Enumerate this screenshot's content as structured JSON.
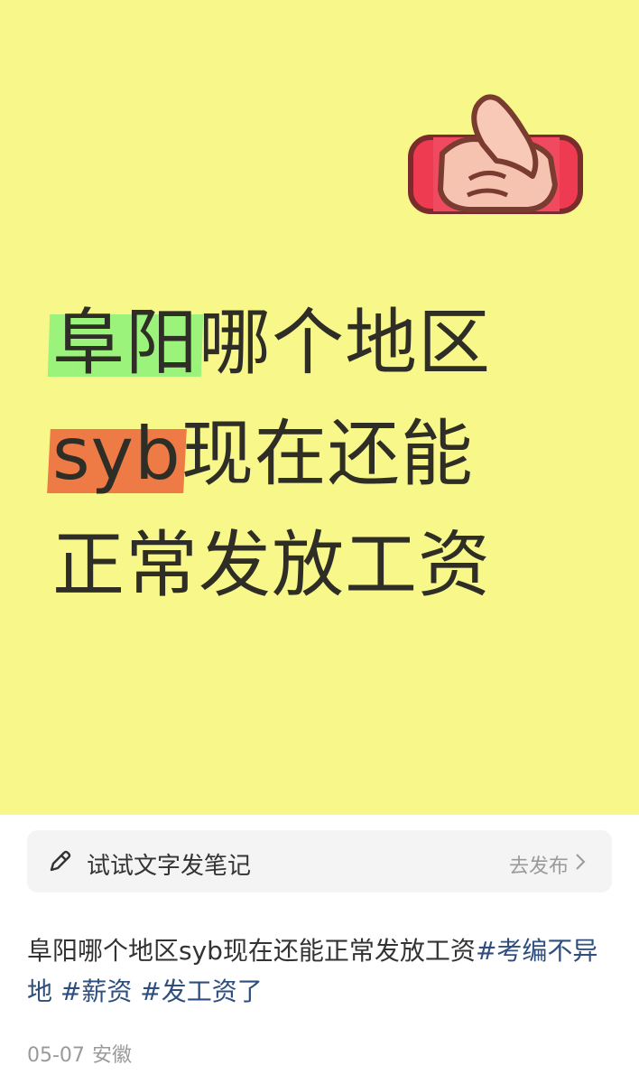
{
  "cover": {
    "line1_highlight": "阜阳",
    "line1_rest": "哪个地区",
    "line2_highlight": "syb",
    "line2_rest": "现在还能",
    "line3": "正常发放工资",
    "emoji": "thumbs-up-icon",
    "bg_color": "#f8f78a",
    "highlight_green": "#9bf37b",
    "highlight_orange": "#ee7a45"
  },
  "prompt_bar": {
    "icon": "pencil-icon",
    "text": "试试文字发笔记",
    "action": "去发布",
    "action_icon": "chevron-right-icon"
  },
  "post": {
    "caption_text": "阜阳哪个地区syb现在还能正常发放工资",
    "tags": [
      "#考编不异地",
      "#薪资",
      "#发工资了"
    ],
    "date": "05-07",
    "location": "安徽"
  }
}
